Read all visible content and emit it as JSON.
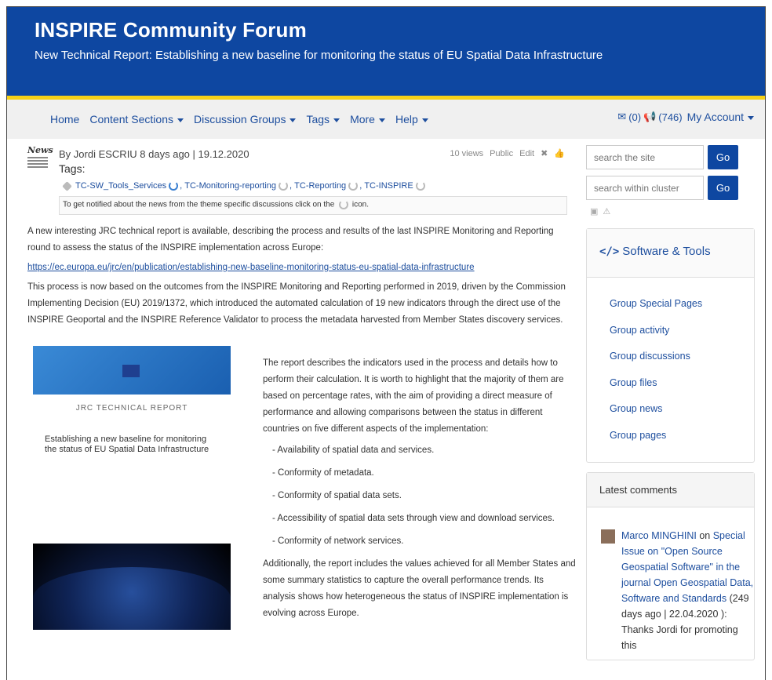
{
  "header": {
    "title": "INSPIRE Community Forum",
    "subtitle": "New Technical Report: Establishing a new baseline for monitoring the status of EU Spatial Data Infrastructure"
  },
  "nav": {
    "items": [
      {
        "label": "Home",
        "dropdown": false
      },
      {
        "label": "Content Sections",
        "dropdown": true
      },
      {
        "label": "Discussion Groups",
        "dropdown": true
      },
      {
        "label": "Tags",
        "dropdown": true
      },
      {
        "label": "More",
        "dropdown": true
      },
      {
        "label": "Help",
        "dropdown": true
      }
    ],
    "messages": "(0)",
    "notifications": "(746)",
    "account": "My Account"
  },
  "post": {
    "news_badge": "News",
    "byline": "By Jordi ESCRIU 8 days ago | 19.12.2020",
    "views": "10 views",
    "visibility": "Public",
    "edit": "Edit",
    "tags_label": "Tags:",
    "tags": [
      "TC-SW_Tools_Services",
      "TC-Monitoring-reporting",
      "TC-Reporting",
      "TC-INSPIRE"
    ],
    "notify": "To get notified about the news from the theme specific discussions click on the",
    "notify_tail": "icon.",
    "p1": "A new interesting JRC technical report is available, describing the process and results of the last INSPIRE Monitoring and Reporting round to assess the status of the INSPIRE implementation across Europe:",
    "link": "https://ec.europa.eu/jrc/en/publication/establishing-new-baseline-monitoring-status-eu-spatial-data-infrastructure",
    "p2": "This process is now based on the outcomes from the INSPIRE Monitoring and Reporting performed in 2019, driven by the Commission Implementing Decision (EU) 2019/1372, which introduced the automated calculation of 19 new indicators through the direct use of the INSPIRE Geoportal and the INSPIRE Reference Validator to process the metadata harvested from Member States discovery services.",
    "cover_label": "JRC TECHNICAL REPORT",
    "cover_title": "Establishing a new baseline for monitoring the status of EU Spatial Data Infrastructure",
    "p3": "The report describes the indicators used in the process and details how to perform their calculation. It is worth to highlight that the majority of them are based on percentage rates, with the aim of providing a direct measure of performance and allowing comparisons between the status in different countries on five different aspects of the implementation:",
    "bullets": [
      "- Availability of spatial data and services.",
      "- Conformity of metadata.",
      "- Conformity of spatial data sets.",
      "- Accessibility of spatial data sets through view and download services.",
      "- Conformity of network services."
    ],
    "p4": "Additionally, the report includes the values achieved for all Member States and some summary statistics to capture the overall performance trends. Its analysis shows how heterogeneous the status of INSPIRE implementation is evolving across Europe."
  },
  "sidebar": {
    "search1_placeholder": "search the site",
    "search2_placeholder": "search within cluster",
    "go": "Go",
    "group_title": "Software & Tools",
    "group_links": [
      "Group Special Pages",
      "Group activity",
      "Group discussions",
      "Group files",
      "Group news",
      "Group pages"
    ],
    "comments_title": "Latest comments",
    "comment": {
      "author": "Marco MINGHINI",
      "on": " on",
      "target": "Special Issue on \"Open Source Geospatial Software\" in the journal Open Geospatial Data, Software and Standards",
      "when": "(249 days ago | 22.04.2020 ): Thanks Jordi for promoting this"
    }
  }
}
